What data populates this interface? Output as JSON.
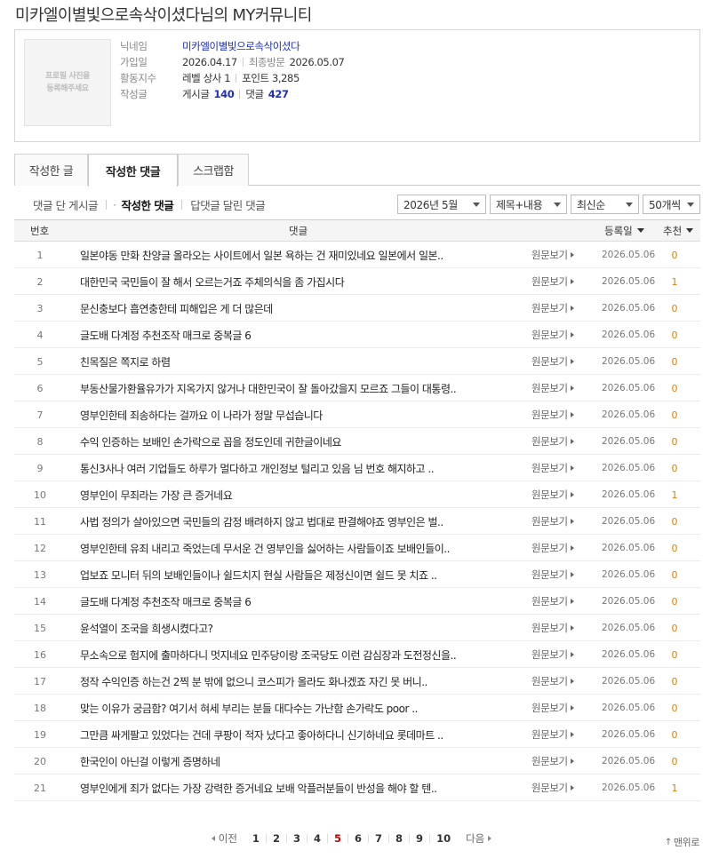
{
  "page_title": "미카엘이별빛으로속삭이셨다님의 MY커뮤니티",
  "profile": {
    "photo_line1": "프로필 사진을",
    "photo_line2": "등록해주세요",
    "nickname_label": "닉네임",
    "nickname": "미카엘이별빛으로속삭이셨다",
    "joined_label": "가입일",
    "joined": "2026.04.17",
    "last_visit_label": "최종방문",
    "last_visit": "2026.05.07",
    "activity_label": "활동지수",
    "level": "레벨 상사 1",
    "points": "포인트 3,285",
    "written_label": "작성글",
    "posts_label": "게시글",
    "posts_count": "140",
    "comments_label": "댓글",
    "comments_count": "427"
  },
  "tabs": [
    "작성한 글",
    "작성한 댓글",
    "스크랩함"
  ],
  "active_tab": "작성한 댓글",
  "subnav": [
    "댓글 단 게시글",
    "작성한 댓글",
    "답댓글 달린 댓글"
  ],
  "filters": {
    "month": "2026년 5월",
    "scope": "제목+내용",
    "order": "최신순",
    "count": "50개씩"
  },
  "columns": {
    "num": "번호",
    "comment": "댓글",
    "date": "등록일",
    "rec": "추천"
  },
  "view_label": "원문보기",
  "rows": [
    {
      "num": "1",
      "text": "일본야동 만화 찬양글 올라오는 사이트에서 일본 욕하는 건 재미있네요 일본에서 일본..",
      "date": "2026.05.06",
      "rec": "0"
    },
    {
      "num": "2",
      "text": "대한민국 국민들이 잘 해서 오르는거죠 주체의식을 좀 가집시다",
      "date": "2026.05.06",
      "rec": "1"
    },
    {
      "num": "3",
      "text": "문신충보다 흡연충한테 피해입은 게 더 많은데",
      "date": "2026.05.06",
      "rec": "0"
    },
    {
      "num": "4",
      "text": "글도배 다계정 추천조작 매크로 중복글 6",
      "date": "2026.05.06",
      "rec": "0"
    },
    {
      "num": "5",
      "text": "친목질은 쪽지로 하렴",
      "date": "2026.05.06",
      "rec": "0"
    },
    {
      "num": "6",
      "text": "부동산물가환율유가가 지옥가지 않거나 대한민국이 잘 돌아갔을지 모르죠 그들이 대통령..",
      "date": "2026.05.06",
      "rec": "0"
    },
    {
      "num": "7",
      "text": "영부인한테 죄송하다는 걸까요 이 나라가 정말 무섭습니다",
      "date": "2026.05.06",
      "rec": "0"
    },
    {
      "num": "8",
      "text": "수익 인증하는 보배인 손가락으로 꼽을 정도인데 귀한글이네요",
      "date": "2026.05.06",
      "rec": "0"
    },
    {
      "num": "9",
      "text": "통신3사나 여러 기업들도 하루가 멀다하고 개인정보 털리고 있음 님 번호 해지하고 ..",
      "date": "2026.05.06",
      "rec": "0"
    },
    {
      "num": "10",
      "text": "영부인이 무죄라는 가장 큰 증거네요",
      "date": "2026.05.06",
      "rec": "1"
    },
    {
      "num": "11",
      "text": "사법 정의가 살아있으면 국민들의 감정 배려하지 않고 법대로 판결해야죠 영부인은 벌..",
      "date": "2026.05.06",
      "rec": "0"
    },
    {
      "num": "12",
      "text": "영부인한테 유죄 내리고 죽었는데 무서운 건 영부인을 싫어하는 사람들이죠 보배인들이..",
      "date": "2026.05.06",
      "rec": "0"
    },
    {
      "num": "13",
      "text": "업보죠 모니터 뒤의 보배인들이나 쉴드치지 현실 사람들은 제정신이면 쉴드 못 치죠 ..",
      "date": "2026.05.06",
      "rec": "0"
    },
    {
      "num": "14",
      "text": "글도배 다계정 추천조작 매크로 중복글 6",
      "date": "2026.05.06",
      "rec": "0"
    },
    {
      "num": "15",
      "text": "윤석열이 조국을 희생시켰다고?",
      "date": "2026.05.06",
      "rec": "0"
    },
    {
      "num": "16",
      "text": "무소속으로 험지에 출마하다니 멋지네요 민주당이랑 조국당도 이런 감심장과 도전정신을..",
      "date": "2026.05.06",
      "rec": "0"
    },
    {
      "num": "17",
      "text": "정작 수익인증 하는건 2찍 분 밖에 없으니 코스피가 올라도 화나겠죠 자긴 못 버니..",
      "date": "2026.05.06",
      "rec": "0"
    },
    {
      "num": "18",
      "text": "맞는 이유가 궁금함? 여기서 혀세 부리는 분들 대다수는 가난함 손가락도 poor ..",
      "date": "2026.05.06",
      "rec": "0"
    },
    {
      "num": "19",
      "text": "그만큼 싸게팔고 있었다는 건데 쿠팡이 적자 났다고 좋아하다니 신기하네요 롯데마트 ..",
      "date": "2026.05.06",
      "rec": "0"
    },
    {
      "num": "20",
      "text": "한국인이 아닌걸 이렇게 증명하네",
      "date": "2026.05.06",
      "rec": "0"
    },
    {
      "num": "21",
      "text": "영부인에게 죄가 없다는 가장 강력한 증거네요 보배 악플러분들이 반성을 해야 할 텐..",
      "date": "2026.05.06",
      "rec": "1"
    }
  ],
  "pagination": {
    "prev": "이전",
    "next": "다음",
    "pages": [
      "1",
      "2",
      "3",
      "4",
      "5",
      "6",
      "7",
      "8",
      "9",
      "10"
    ],
    "current": "5"
  },
  "to_top": "맨위로",
  "colors": {
    "accent_blue": "#1d2fb8",
    "recommend_orange": "#e07f00",
    "current_page_red": "#cc0000"
  }
}
